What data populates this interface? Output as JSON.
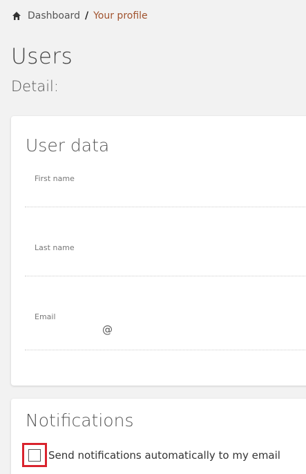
{
  "breadcrumb": {
    "home_icon": "home-icon",
    "dashboard": "Dashboard",
    "separator": "/",
    "current": "Your profile"
  },
  "page": {
    "title": "Users",
    "subtitle": "Detail:"
  },
  "user_data": {
    "title": "User data",
    "first_name": {
      "label": "First name",
      "value": ""
    },
    "last_name": {
      "label": "Last name",
      "value": ""
    },
    "email": {
      "label": "Email",
      "value": "@"
    }
  },
  "notifications": {
    "title": "Notifications",
    "send_email_label": "Send notifications automatically to my email",
    "send_email_checked": false
  },
  "colors": {
    "background": "#f2f2f2",
    "card": "#ffffff",
    "breadcrumb_current": "#a0522d",
    "highlight": "#d9232d"
  }
}
